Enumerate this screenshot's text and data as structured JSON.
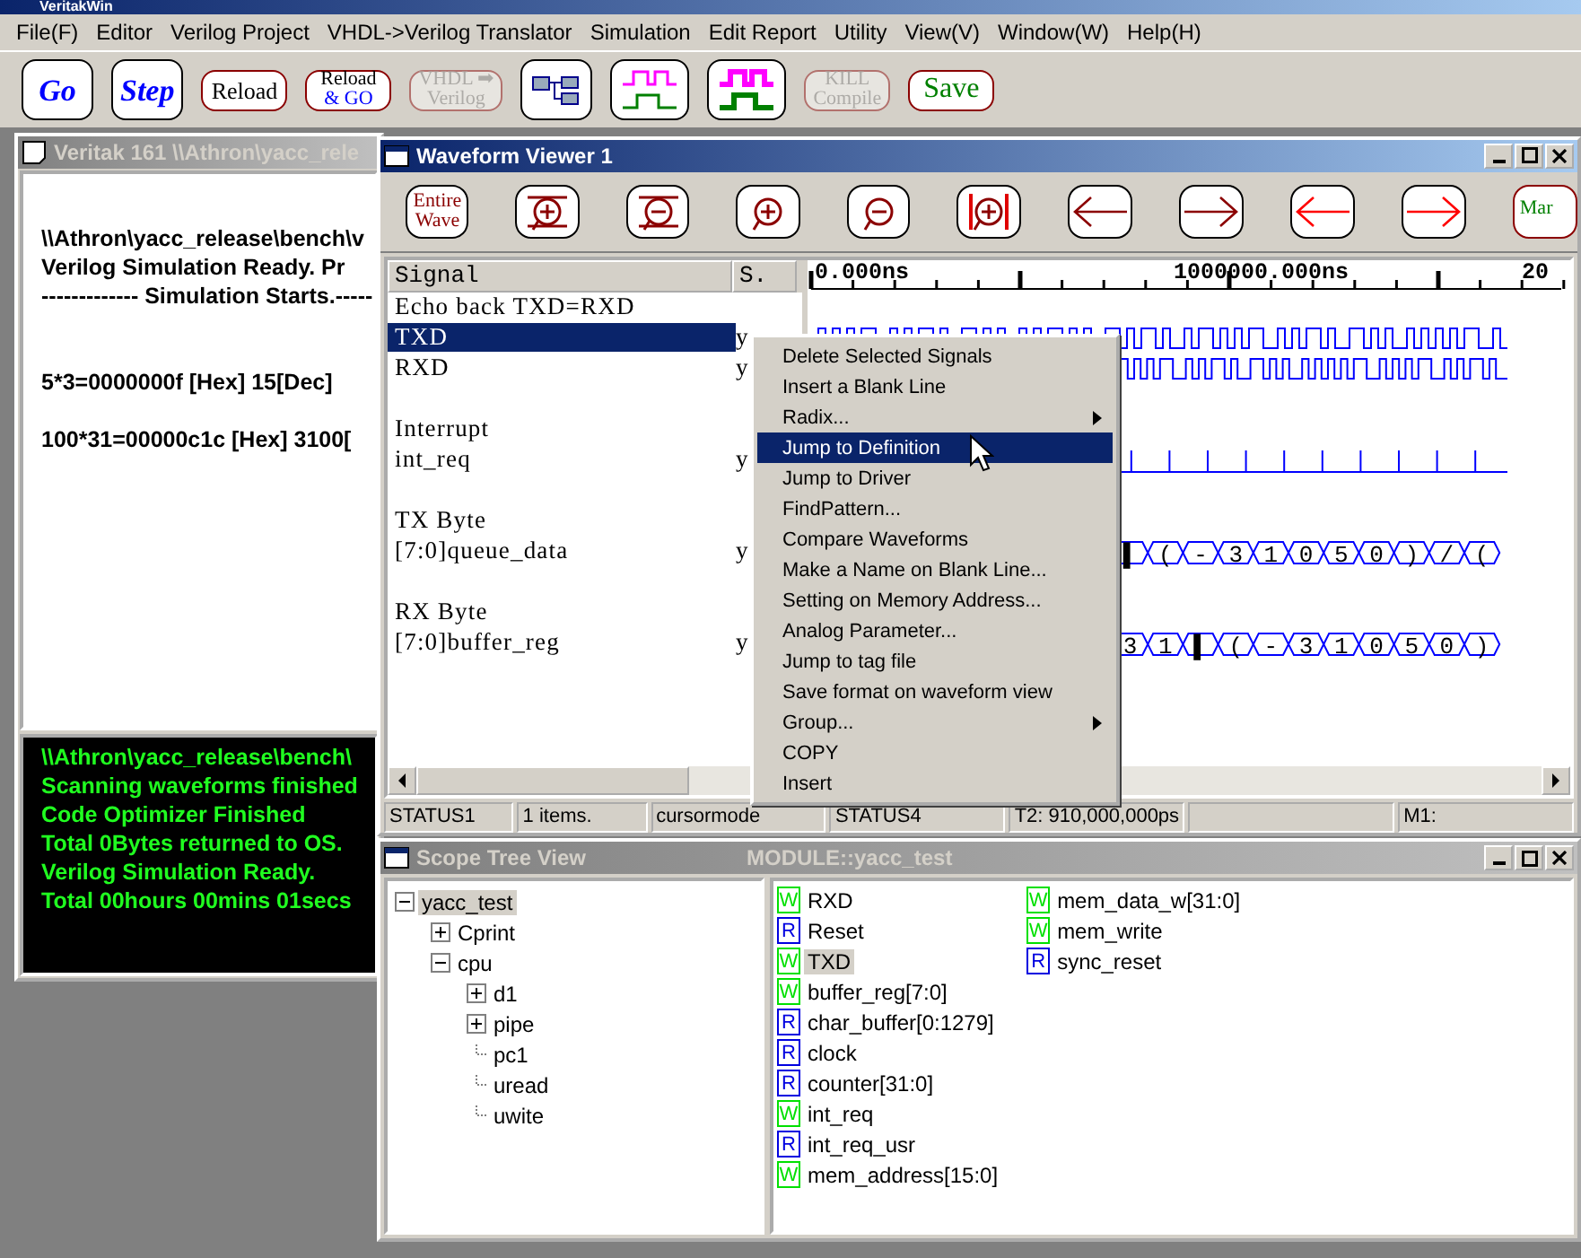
{
  "app_title": "VeritakWin",
  "menu": [
    "File(F)",
    "Editor",
    "Verilog Project",
    "VHDL->Verilog Translator",
    "Simulation",
    "Edit Report",
    "Utility",
    "View(V)",
    "Window(W)",
    "Help(H)"
  ],
  "toolbar": [
    {
      "kind": "bigblue",
      "label": "Go",
      "disabled": false
    },
    {
      "kind": "bigblue",
      "label": "Step",
      "disabled": false
    },
    {
      "kind": "plain",
      "label": "Reload",
      "disabled": false
    },
    {
      "kind": "twoline",
      "label": "Reload",
      "label2": "& GO",
      "disabled": false
    },
    {
      "kind": "twoline",
      "label": "VHDL ➡",
      "label2": "Verilog",
      "disabled": true
    },
    {
      "kind": "tree",
      "disabled": false
    },
    {
      "kind": "wave",
      "disabled": false
    },
    {
      "kind": "wavebold",
      "disabled": false
    },
    {
      "kind": "twoline",
      "label": "KILL",
      "label2": "Compile",
      "disabled": true
    },
    {
      "kind": "green",
      "label": "Save",
      "disabled": false
    }
  ],
  "console": {
    "title": "Veritak 161 \\\\Athron\\yacc_rele",
    "paragraphs": [
      [
        "\\\\Athron\\yacc_release\\bench\\v",
        "Verilog Simulation Ready. Pr",
        "------------- Simulation Starts.-----"
      ],
      [
        "5*3=0000000f [Hex]    15[Dec]"
      ],
      [
        "100*31=00000c1c [Hex]   3100["
      ]
    ],
    "log": [
      "\\\\Athron\\yacc_release\\bench\\",
      "Scanning waveforms finished",
      "Code Optimizer Finished",
      "Total 0Bytes returned to OS.",
      "Verilog Simulation Ready.",
      "Total  00hours 00mins 01secs"
    ]
  },
  "waveform_viewer": {
    "title": "Waveform Viewer 1",
    "tools": [
      {
        "kind": "text",
        "label": "Entire",
        "label2": "Wave"
      },
      {
        "kind": "zoomin"
      },
      {
        "kind": "zoomout"
      },
      {
        "kind": "plus"
      },
      {
        "kind": "minus"
      },
      {
        "kind": "cursorzoom"
      },
      {
        "kind": "left"
      },
      {
        "kind": "right"
      },
      {
        "kind": "leftred"
      },
      {
        "kind": "rightred"
      },
      {
        "kind": "mark",
        "label": "Mar"
      }
    ],
    "columns": [
      "Signal",
      "S."
    ],
    "ruler": [
      "0.000ns",
      "1000000.000ns",
      "20"
    ],
    "signals": [
      {
        "kind": "comment",
        "name": "Echo back TXD=RXD"
      },
      {
        "kind": "bits",
        "name": "TXD",
        "value": "y",
        "selected": true
      },
      {
        "kind": "bits",
        "name": "RXD",
        "value": "y",
        "selected": false
      },
      {
        "kind": "blank"
      },
      {
        "kind": "comment",
        "name": "Interrupt"
      },
      {
        "kind": "pulse",
        "name": "int_req",
        "value": "y",
        "selected": false
      },
      {
        "kind": "blank"
      },
      {
        "kind": "comment",
        "name": "TX Byte"
      },
      {
        "kind": "bus",
        "name": "[7:0]queue_data",
        "value": "y",
        "selected": false,
        "bus_values": [
          "▌",
          "(",
          "-",
          "3",
          "1",
          "0",
          "5",
          "0",
          ")",
          "/",
          "("
        ]
      },
      {
        "kind": "blank"
      },
      {
        "kind": "comment",
        "name": "RX Byte"
      },
      {
        "kind": "bus",
        "name": "[7:0]buffer_reg",
        "value": "y",
        "selected": false,
        "bus_values": [
          "3",
          "1",
          "▌",
          "(",
          "-",
          "3",
          "1",
          "0",
          "5",
          "0",
          ")"
        ]
      }
    ],
    "status_bar": [
      "STATUS1",
      "1 items.",
      "cursormode",
      "STATUS4",
      "T2: 910,000,000ps",
      "M1:"
    ],
    "context_menu": [
      {
        "label": "Delete Selected Signals",
        "submenu": false,
        "selected": false
      },
      {
        "label": "Insert a Blank Line",
        "submenu": false,
        "selected": false
      },
      {
        "label": "Radix...",
        "submenu": true,
        "selected": false
      },
      {
        "label": "Jump to Definition",
        "submenu": false,
        "selected": true
      },
      {
        "label": "Jump to Driver",
        "submenu": false,
        "selected": false
      },
      {
        "label": "FindPattern...",
        "submenu": false,
        "selected": false
      },
      {
        "label": "Compare Waveforms",
        "submenu": false,
        "selected": false
      },
      {
        "label": "Make a Name on Blank Line...",
        "submenu": false,
        "selected": false
      },
      {
        "label": "Setting on Memory Address...",
        "submenu": false,
        "selected": false
      },
      {
        "label": "Analog Parameter...",
        "submenu": false,
        "selected": false
      },
      {
        "label": "Jump to tag file",
        "submenu": false,
        "selected": false
      },
      {
        "label": "Save format on waveform view",
        "submenu": false,
        "selected": false
      },
      {
        "label": "Group...",
        "submenu": true,
        "selected": false
      },
      {
        "label": "COPY",
        "submenu": false,
        "selected": false
      },
      {
        "label": "Insert",
        "submenu": false,
        "selected": false
      }
    ]
  },
  "scope_tree": {
    "title": "Scope Tree View",
    "module": "MODULE::yacc_test",
    "tree": [
      {
        "label": "yacc_test",
        "expanded": true,
        "selected": true,
        "children": [
          {
            "label": "Cprint",
            "expanded": false,
            "selected": false
          },
          {
            "label": "cpu",
            "expanded": true,
            "selected": false,
            "children": [
              {
                "label": "d1",
                "expanded": false,
                "selected": false
              },
              {
                "label": "pipe",
                "expanded": false,
                "selected": false
              },
              {
                "label": "pc1",
                "selected": false
              },
              {
                "label": "uread",
                "selected": false
              },
              {
                "label": "uwite",
                "selected": false
              }
            ]
          }
        ]
      }
    ],
    "nets": [
      {
        "color": "#00e000",
        "letter": "W",
        "name": "RXD",
        "selected": false
      },
      {
        "color": "#0000e0",
        "letter": "R",
        "name": "Reset",
        "selected": false
      },
      {
        "color": "#00e000",
        "letter": "W",
        "name": "TXD",
        "selected": true
      },
      {
        "color": "#00e000",
        "letter": "W",
        "name": "buffer_reg[7:0]",
        "selected": false
      },
      {
        "color": "#0000e0",
        "letter": "R",
        "name": "char_buffer[0:1279]",
        "selected": false
      },
      {
        "color": "#0000e0",
        "letter": "R",
        "name": "clock",
        "selected": false
      },
      {
        "color": "#0000e0",
        "letter": "R",
        "name": "counter[31:0]",
        "selected": false
      },
      {
        "color": "#00e000",
        "letter": "W",
        "name": "int_req",
        "selected": false
      },
      {
        "color": "#0000e0",
        "letter": "R",
        "name": "int_req_usr",
        "selected": false
      },
      {
        "color": "#00e000",
        "letter": "W",
        "name": "mem_address[15:0]",
        "selected": false
      },
      {
        "color": "#00e000",
        "letter": "W",
        "name": "mem_data_w[31:0]",
        "selected": false
      },
      {
        "color": "#00e000",
        "letter": "W",
        "name": "mem_write",
        "selected": false
      },
      {
        "color": "#0000e0",
        "letter": "R",
        "name": "sync_reset",
        "selected": false
      }
    ]
  }
}
